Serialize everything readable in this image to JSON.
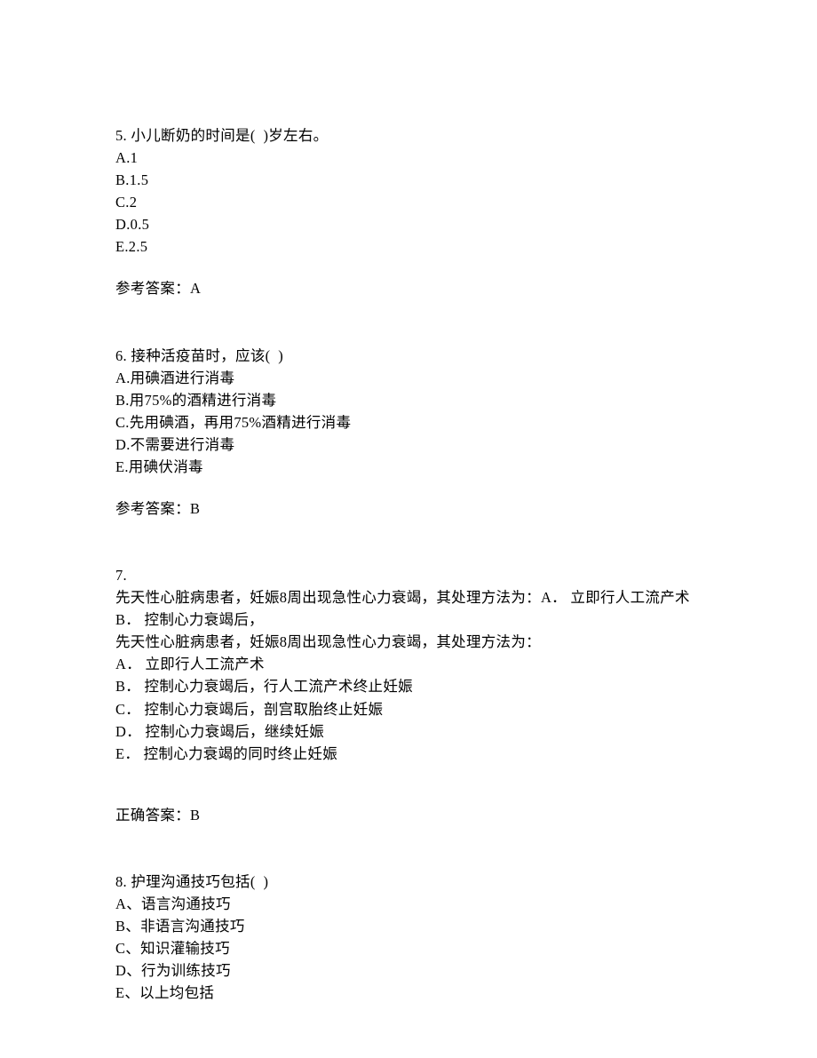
{
  "questions": [
    {
      "number": "5.",
      "stem": "小儿断奶的时间是(  )岁左右。",
      "options": [
        "A.1",
        "B.1.5",
        "C.2",
        "D.0.5",
        "E.2.5"
      ],
      "answer_label": "参考答案：",
      "answer_value": "A"
    },
    {
      "number": "6.",
      "stem": "接种活疫苗时，应该(  )",
      "options": [
        "A.用碘酒进行消毒",
        "B.用75%的酒精进行消毒",
        "C.先用碘酒，再用75%酒精进行消毒",
        "D.不需要进行消毒",
        "E.用碘伏消毒"
      ],
      "answer_label": "参考答案：",
      "answer_value": "B"
    },
    {
      "number": "7.",
      "pre_lines": [
        "先天性心脏病患者，妊娠8周出现急性心力衰竭，其处理方法为：A． 立即行人工流产术B． 控制心力衰竭后，",
        "先天性心脏病患者，妊娠8周出现急性心力衰竭，其处理方法为："
      ],
      "options": [
        "A． 立即行人工流产术",
        "B． 控制心力衰竭后，行人工流产术终止妊娠",
        "C． 控制心力衰竭后，剖宫取胎终止妊娠",
        "D． 控制心力衰竭后，继续妊娠",
        "E． 控制心力衰竭的同时终止妊娠"
      ],
      "answer_label": "正确答案：",
      "answer_value": "B"
    },
    {
      "number": "8.",
      "stem": "护理沟通技巧包括(  )",
      "options": [
        "A、语言沟通技巧",
        "B、非语言沟通技巧",
        "C、知识灌输技巧",
        "D、行为训练技巧",
        "E、以上均包括"
      ]
    }
  ]
}
